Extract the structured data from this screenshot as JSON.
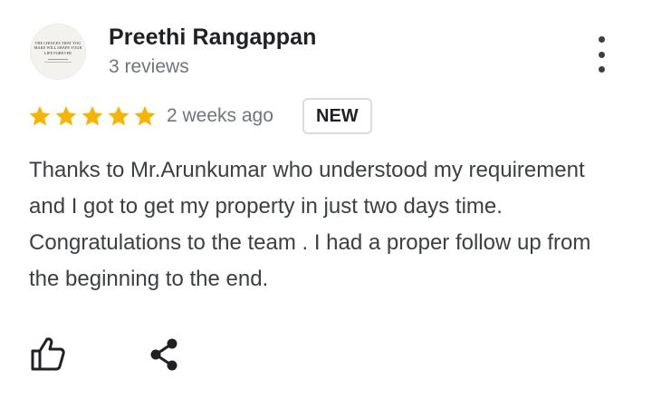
{
  "reviewer": {
    "name": "Preethi Rangappan",
    "review_count": "3 reviews",
    "avatar_lines": [
      "THE CHOICES THAT YOU",
      "MAKE WILL SHAPE YOUR",
      "LIFE FOREVER"
    ]
  },
  "review": {
    "rating": 5,
    "max_rating": 5,
    "time": "2 weeks ago",
    "badge": "NEW",
    "text": "Thanks to Mr.Arunkumar who understood my requirement and I got to get my property in just two days time. Congratulations to the team . I had a proper follow up from the beginning to the end."
  },
  "icons": {
    "more": "more-vert-icon",
    "star": "star-icon",
    "like": "thumb-up-icon",
    "share": "share-icon"
  },
  "colors": {
    "star": "#f4b400",
    "primary_text": "#202124",
    "secondary_text": "#70757a",
    "body_text": "#3c4043",
    "badge_border": "#dadce0"
  }
}
